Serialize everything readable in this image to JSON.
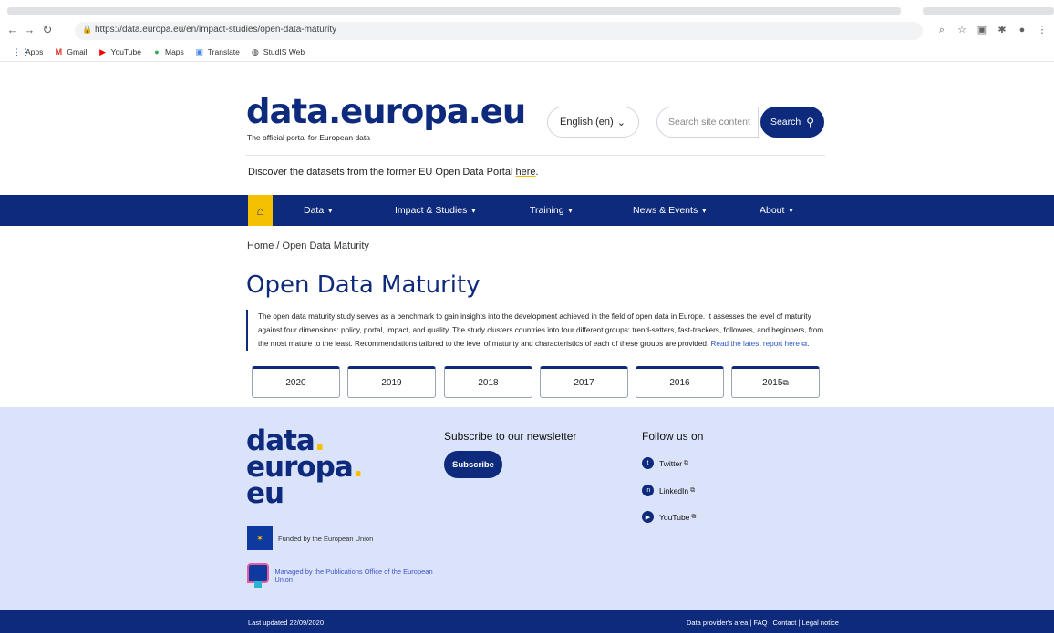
{
  "browser": {
    "url": "https://data.europa.eu/en/impact-studies/open-data-maturity",
    "bookmarks": [
      {
        "label": "Apps",
        "icon": "apps-grid-icon"
      },
      {
        "label": "Gmail",
        "icon": "gmail-icon"
      },
      {
        "label": "YouTube",
        "icon": "youtube-icon"
      },
      {
        "label": "Maps",
        "icon": "maps-pin-icon"
      },
      {
        "label": "Translate",
        "icon": "translate-icon"
      },
      {
        "label": "StudIS Web",
        "icon": "studis-icon"
      }
    ]
  },
  "header": {
    "logo": "data.europa.eu",
    "tagline": "The official portal for European data",
    "language": "English (en)",
    "search_placeholder": "Search site content",
    "search_label": "Search",
    "notice_text": "Discover the datasets from the former EU Open Data Portal ",
    "notice_link": "here",
    "notice_end": "."
  },
  "nav": {
    "items": [
      {
        "label": "Data"
      },
      {
        "label": "Impact & Studies"
      },
      {
        "label": "Training"
      },
      {
        "label": "News & Events"
      },
      {
        "label": "About"
      }
    ]
  },
  "content": {
    "breadcrumb": "Home / Open Data Maturity",
    "title": "Open Data Maturity",
    "intro": "The open data maturity study serves as a benchmark to gain insights into the development achieved in the field of open data in Europe. It assesses the level of maturity against four dimensions: policy, portal, impact, and quality. The study clusters countries into four different groups: trend-setters, fast-trackers, followers, and beginners, from the most mature to the least. Recommendations tailored to the level of maturity and characteristics of each of these groups are provided. ",
    "intro_link": "Read the latest report here",
    "years": [
      "2020",
      "2019",
      "2018",
      "2017",
      "2016",
      "2015"
    ]
  },
  "footer": {
    "logo_line1": "data",
    "logo_line2": "europa",
    "logo_line3": "eu",
    "funded": "Funded by the European Union",
    "managed": "Managed by the Publications Office of the European Union",
    "newsletter_title": "Subscribe to our newsletter",
    "subscribe_label": "Subscribe",
    "follow_title": "Follow us on",
    "social": [
      {
        "label": "Twitter",
        "icon": "twitter-icon"
      },
      {
        "label": "LinkedIn",
        "icon": "linkedin-icon"
      },
      {
        "label": "YouTube",
        "icon": "youtube-icon"
      }
    ],
    "updated": "Last updated 22/09/2020",
    "legal": "Data provider's area | FAQ | Contact | Legal notice"
  },
  "colors": {
    "primary": "#0e2a7d",
    "accent": "#f4c000",
    "footer_bg": "#dbe3fa"
  }
}
